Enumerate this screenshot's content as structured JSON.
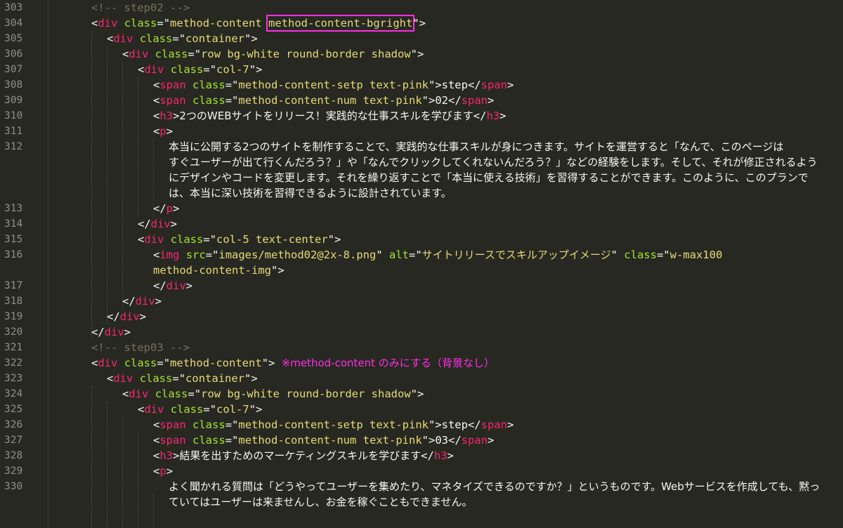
{
  "editor": {
    "line_numbers": [
      "303",
      "304",
      "305",
      "306",
      "307",
      "308",
      "309",
      "310",
      "311",
      "312",
      "313",
      "314",
      "315",
      "316",
      "317",
      "318",
      "319",
      "320",
      "321",
      "322",
      "323",
      "324",
      "325",
      "326",
      "327",
      "328",
      "329",
      "330"
    ],
    "highlight_color": "#ff2ee6",
    "lines": {
      "l303": {
        "comment": "<!-- step02 -->"
      },
      "l304": {
        "open": "<",
        "tag": "div",
        "attr": "class",
        "eq": "=\"",
        "value_a": "method-content ",
        "value_hl": "method-content-bgright",
        "close": "\">"
      },
      "l305": {
        "open": "<",
        "tag": "div",
        "attr": "class",
        "eq": "=\"",
        "value": "container",
        "close": "\">"
      },
      "l306": {
        "open": "<",
        "tag": "div",
        "attr": "class",
        "eq": "=\"",
        "value": "row bg-white round-border shadow",
        "close": "\">"
      },
      "l307": {
        "open": "<",
        "tag": "div",
        "attr": "class",
        "eq": "=\"",
        "value": "col-7",
        "close": "\">"
      },
      "l308": {
        "open": "<",
        "tag": "span",
        "attr": "class",
        "eq": "=\"",
        "value": "method-content-setp text-pink",
        "mid": "\">step</",
        "tag2": "span",
        "close": ">"
      },
      "l309": {
        "open": "<",
        "tag": "span",
        "attr": "class",
        "eq": "=\"",
        "value": "method-content-num text-pink",
        "mid": "\">02</",
        "tag2": "span",
        "close": ">"
      },
      "l310": {
        "open": "<",
        "tag": "h3",
        "mid": ">",
        "text": "2つのWEBサイトをリリース！実践的な仕事スキルを学びます",
        "mid2": "</",
        "tag2": "h3",
        "close": ">"
      },
      "l311": {
        "open": "<",
        "tag": "p",
        "close": ">"
      },
      "l312": [
        "本当に公開する2つのサイトを制作することで、実践的な仕事スキルが身につきます。サイトを運営すると「なんで、このページは",
        "すぐユーザーが出て行くんだろう？」や「なんでクリックしてくれないんだろう？」などの経験をします。そして、それが修正されるよう",
        "にデザインやコードを変更します。それを繰り返すことで「本当に使える技術」を習得することができます。このように、このプランで",
        "は、本当に深い技術を習得できるように設計されています。"
      ],
      "l313": {
        "open": "</",
        "tag": "p",
        "close": ">"
      },
      "l314": {
        "open": "</",
        "tag": "div",
        "close": ">"
      },
      "l315": {
        "open": "<",
        "tag": "div",
        "attr": "class",
        "eq": "=\"",
        "value": "col-5 text-center",
        "close": "\">"
      },
      "l316": {
        "open": "<",
        "tag": "img",
        "attr": "src",
        "eq": "=\"",
        "value": "images/method02@2x-8.png",
        "q": "\" ",
        "attr2": "alt",
        "eq2": "=\"",
        "value2": "サイトリリースでスキルアップイメージ",
        "q2": "\" ",
        "attr3": "class",
        "eq3": "=\"",
        "value3": "w-max100",
        "wrap": "method-content-img",
        "close": "\">"
      },
      "l317": {
        "open": "</",
        "tag": "div",
        "close": ">"
      },
      "l318": {
        "open": "</",
        "tag": "div",
        "close": ">"
      },
      "l319": {
        "open": "</",
        "tag": "div",
        "close": ">"
      },
      "l320": {
        "open": "</",
        "tag": "div",
        "close": ">"
      },
      "l321": {
        "comment": "<!-- step03 -->"
      },
      "l322": {
        "open": "<",
        "tag": "div",
        "attr": "class",
        "eq": "=\"",
        "value": "method-content",
        "close": "\">",
        "note": "※method-content のみにする（背景なし）"
      },
      "l323": {
        "open": "<",
        "tag": "div",
        "attr": "class",
        "eq": "=\"",
        "value": "container",
        "close": "\">"
      },
      "l324": {
        "open": "<",
        "tag": "div",
        "attr": "class",
        "eq": "=\"",
        "value": "row bg-white round-border shadow",
        "close": "\">"
      },
      "l325": {
        "open": "<",
        "tag": "div",
        "attr": "class",
        "eq": "=\"",
        "value": "col-7",
        "close": "\">"
      },
      "l326": {
        "open": "<",
        "tag": "span",
        "attr": "class",
        "eq": "=\"",
        "value": "method-content-setp text-pink",
        "mid": "\">step</",
        "tag2": "span",
        "close": ">"
      },
      "l327": {
        "open": "<",
        "tag": "span",
        "attr": "class",
        "eq": "=\"",
        "value": "method-content-num text-pink",
        "mid": "\">03</",
        "tag2": "span",
        "close": ">"
      },
      "l328": {
        "open": "<",
        "tag": "h3",
        "mid": ">",
        "text": "結果を出すためのマーケティングスキルを学びます",
        "mid2": "</",
        "tag2": "h3",
        "close": ">"
      },
      "l329": {
        "open": "<",
        "tag": "p",
        "close": ">"
      },
      "l330": [
        "よく聞かれる質問は「どうやってユーザーを集めたり、マネタイズできるのですか？」というものです。Webサービスを作成しても、黙っ",
        "ていてはユーザーは来ませんし、お金を稼ぐこともできません。"
      ]
    }
  }
}
